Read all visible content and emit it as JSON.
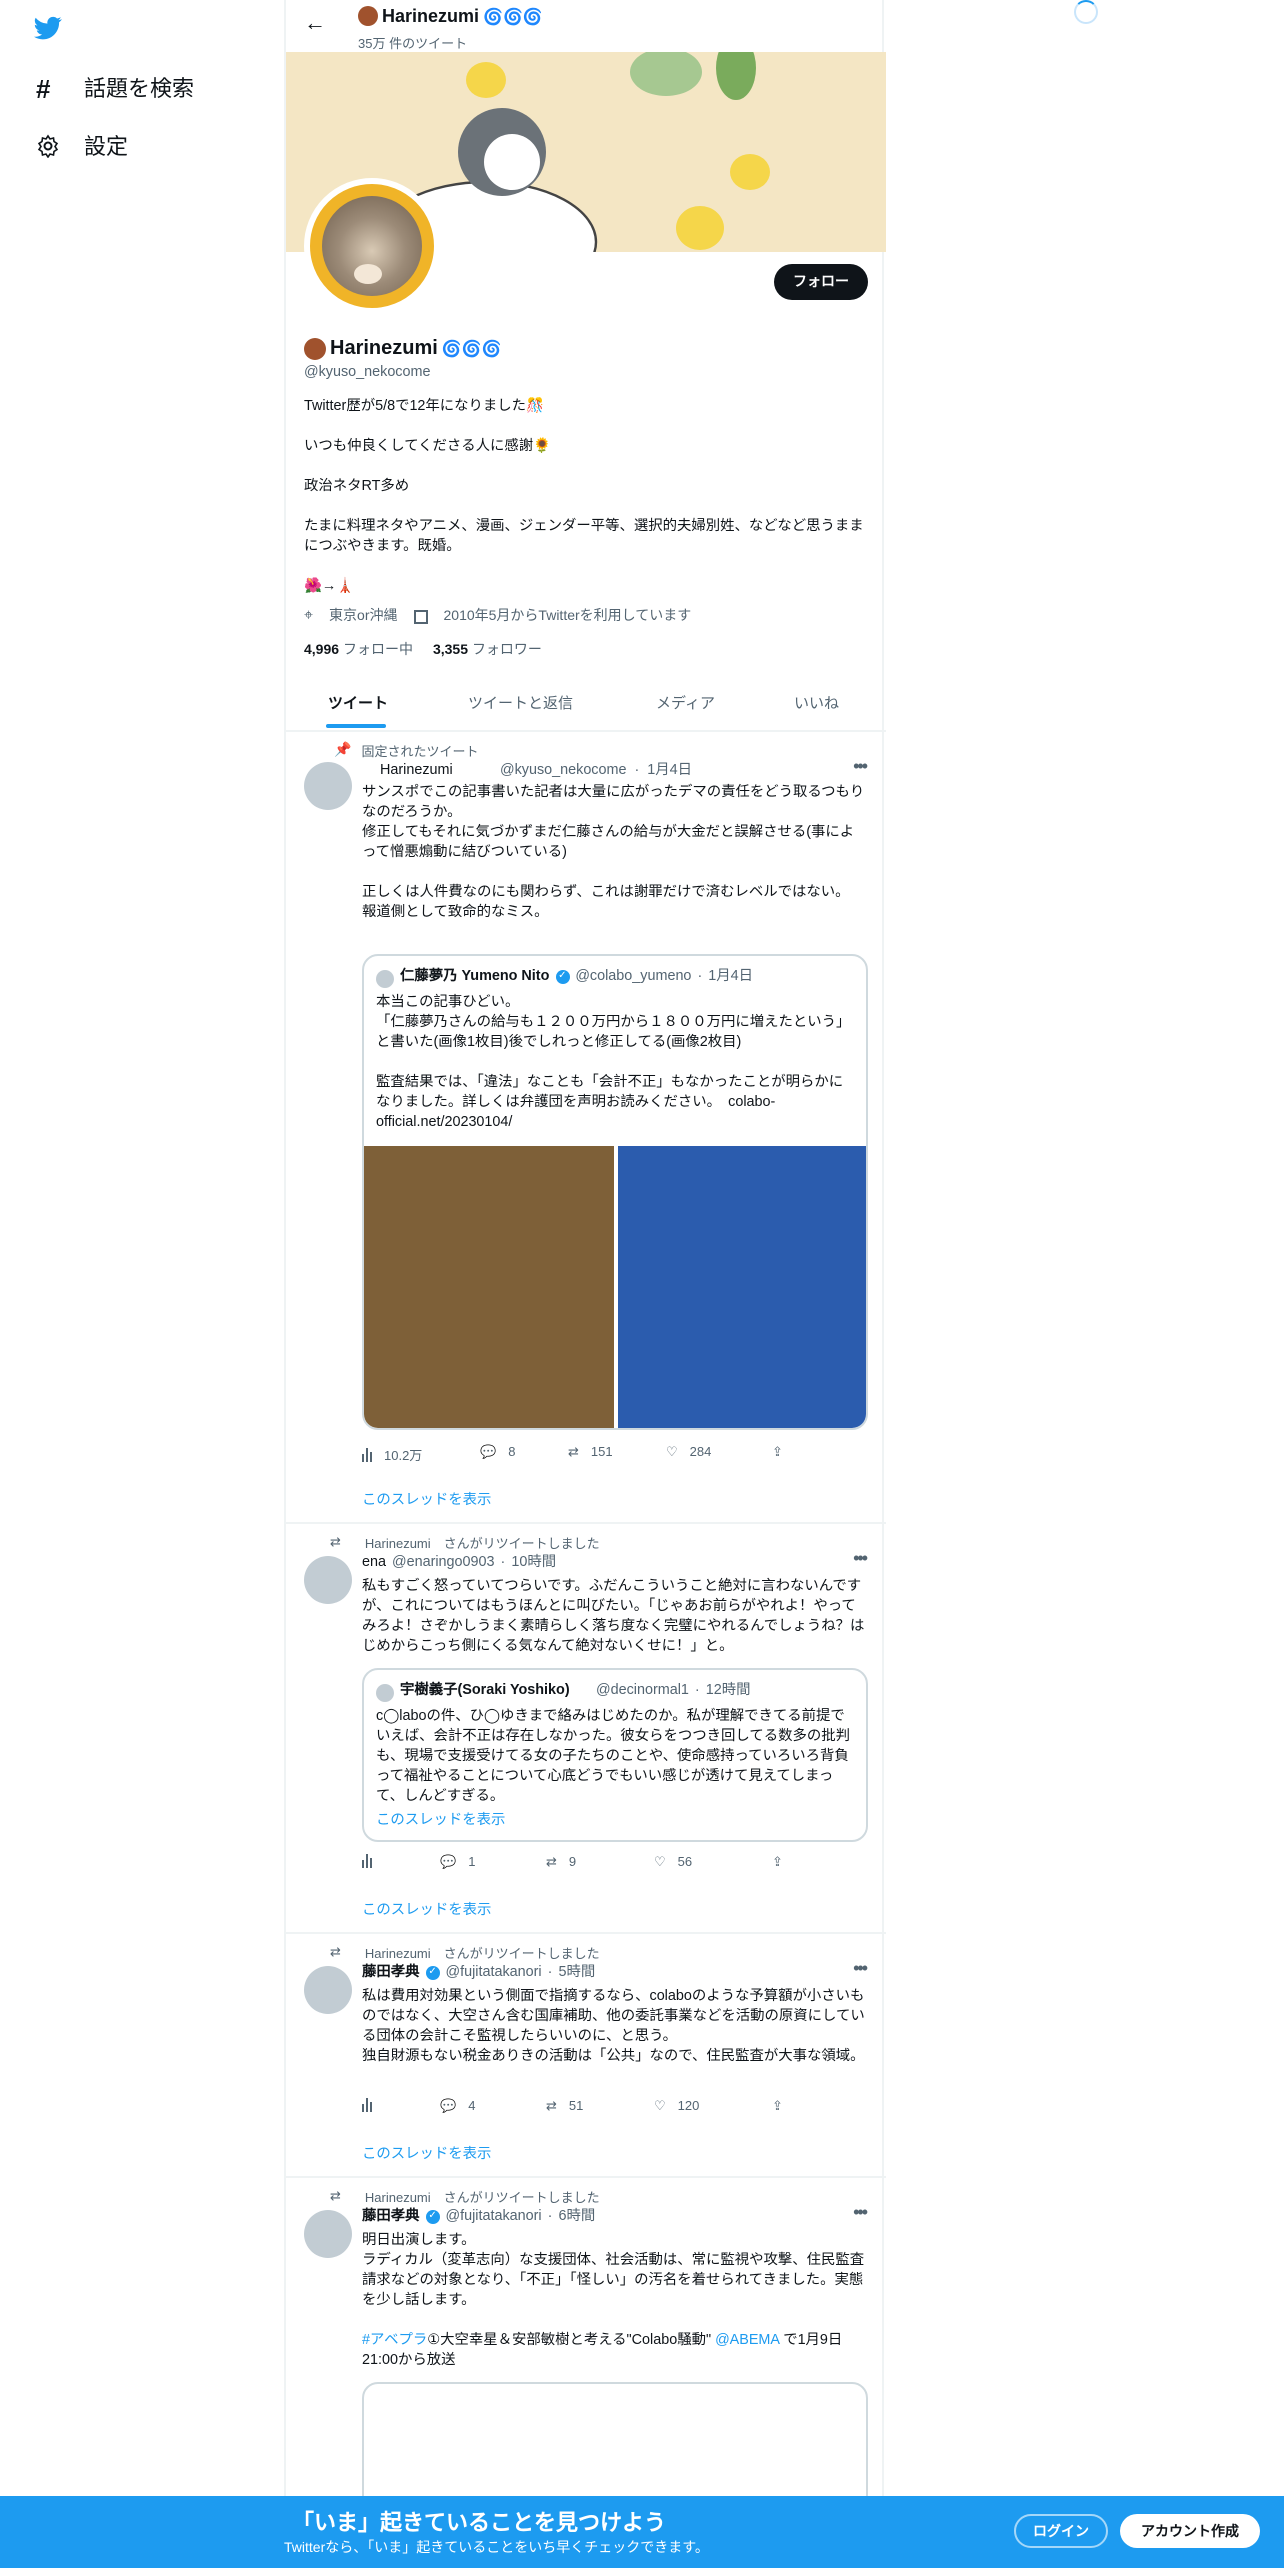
{
  "colors": {
    "accent": "#1d9bf0",
    "dark": "#0f1419",
    "gray": "#536471",
    "banner_bg": "#f4e6c4"
  },
  "sidebar": {
    "logo_icon": "twitter-bird-icon",
    "explore_label": "話題を検索",
    "settings_label": "設定"
  },
  "header": {
    "name": "Harinezumi",
    "tweet_count": "35万 件のツイート"
  },
  "profile": {
    "follow_label": "フォロー",
    "name": "Harinezumi",
    "handle": "@kyuso_nekocome",
    "bio": [
      "Twitter歴が5/8で12年になりました🎊",
      "いつも仲良くしてくださる人に感謝🌻",
      "政治ネタRT多め",
      "たまに料理ネタやアニメ、漫画、ジェンダー平等、選択的夫婦別姓、などなど思うままにつぶやきます。既婚。",
      "🌺→🗼"
    ],
    "location": "東京or沖縄",
    "joined": "2010年5月からTwitterを利用しています",
    "following_count": "4,996",
    "following_label": "フォロー中",
    "followers_count": "3,355",
    "followers_label": "フォロワー"
  },
  "tabs": [
    "ツイート",
    "ツイートと返信",
    "メディア",
    "いいね"
  ],
  "tweets": [
    {
      "context": "固定されたツイート",
      "name": "Harinezumi",
      "handle": "@kyuso_nekocome",
      "time": "1月4日",
      "text": [
        "サンスポでこの記事書いた記者は大量に広がったデマの責任をどう取るつもりなのだろうか。",
        "修正してもそれに気づかずまだ仁藤さんの給与が大金だと誤解させる(事によって憎悪煽動に結びついている)",
        "",
        "正しくは人件費なのにも関わらず、これは謝罪だけで済むレベルではない。",
        "報道側として致命的なミス。"
      ],
      "quote": {
        "name": "仁藤夢乃 Yumeno Nito",
        "handle": "@colabo_yumeno",
        "time": "1月4日",
        "text": [
          "本当この記事ひどい。",
          "「仁藤夢乃さんの給与も１２００万円から１８００万円に増えたという」と書いた(画像1枚目)後でしれっと修正してる(画像2枚目)",
          "",
          "監査結果では、「違法」なことも「会計不正」もなかったことが明らかになりました。詳しくは弁護団を声明お読みください。　colabo-official.net/20230104/"
        ]
      },
      "views": "10.2万",
      "replies": "8",
      "retweets": "151",
      "likes": "284",
      "show_thread": "このスレッドを表示"
    },
    {
      "context": "Harinezumi　さんがリツイートしました",
      "name": "ena",
      "handle": "@enaringo0903",
      "time": "10時間",
      "text": [
        "私もすごく怒っていてつらいです。ふだんこういうこと絶対に言わないんですが、これについてはもうほんとに叫びたい。「じゃあお前らがやれよ！やってみろよ！さぞかしうまく素晴らしく落ち度なく完璧にやれるんでしょうね？はじめからこっち側にくる気なんて絶対ないくせに！」と。"
      ],
      "quote": {
        "name": "宇樹義子(Soraki Yoshiko)",
        "handle": "@decinormal1",
        "time": "12時間",
        "text": [
          "c◯laboの件、ひ◯ゆきまで絡みはじめたのか。私が理解できてる前提でいえば、会計不正は存在しなかった。彼女らをつつき回してる数多の批判も、現場で支援受けてる女の子たちのことや、使命感持っていろいろ背負って福祉やることについて心底どうでもいい感じが透けて見えてしまって、しんどすぎる。"
        ],
        "show_thread": "このスレッドを表示"
      },
      "replies": "1",
      "retweets": "9",
      "likes": "56",
      "show_thread": "このスレッドを表示"
    },
    {
      "context": "Harinezumi　さんがリツイートしました",
      "name": "藤田孝典",
      "handle": "@fujitatakanori",
      "time": "5時間",
      "text": [
        "私は費用対効果という側面で指摘するなら、colaboのような予算額が小さいものではなく、大空さん含む国庫補助、他の委託事業などを活動の原資にしている団体の会計こそ監視したらいいのに、と思う。",
        "独自財源もない税金ありきの活動は「公共」なので、住民監査が大事な領域。"
      ],
      "replies": "4",
      "retweets": "51",
      "likes": "120",
      "show_thread": "このスレッドを表示"
    },
    {
      "context": "Harinezumi　さんがリツイートしました",
      "name": "藤田孝典",
      "handle": "@fujitatakanori",
      "time": "6時間",
      "text": [
        "明日出演します。",
        "ラディカル（変革志向）な支援団体、社会活動は、常に監視や攻撃、住民監査請求などの対象となり、「不正」「怪しい」の汚名を着せられてきました。実態を少し話します。"
      ],
      "hashtag": "#アベプラ",
      "text_after": "①大空幸星＆安部敏樹と考える\"Colabo騒動\"",
      "mention": "@ABEMA",
      "text_end": "で1月9日21:00から放送"
    }
  ],
  "bottom_bar": {
    "title": "「いま」起きていることを見つけよう",
    "subtitle": "Twitterなら、「いま」起きていることをいち早くチェックできます。",
    "login_label": "ログイン",
    "signup_label": "アカウント作成"
  }
}
